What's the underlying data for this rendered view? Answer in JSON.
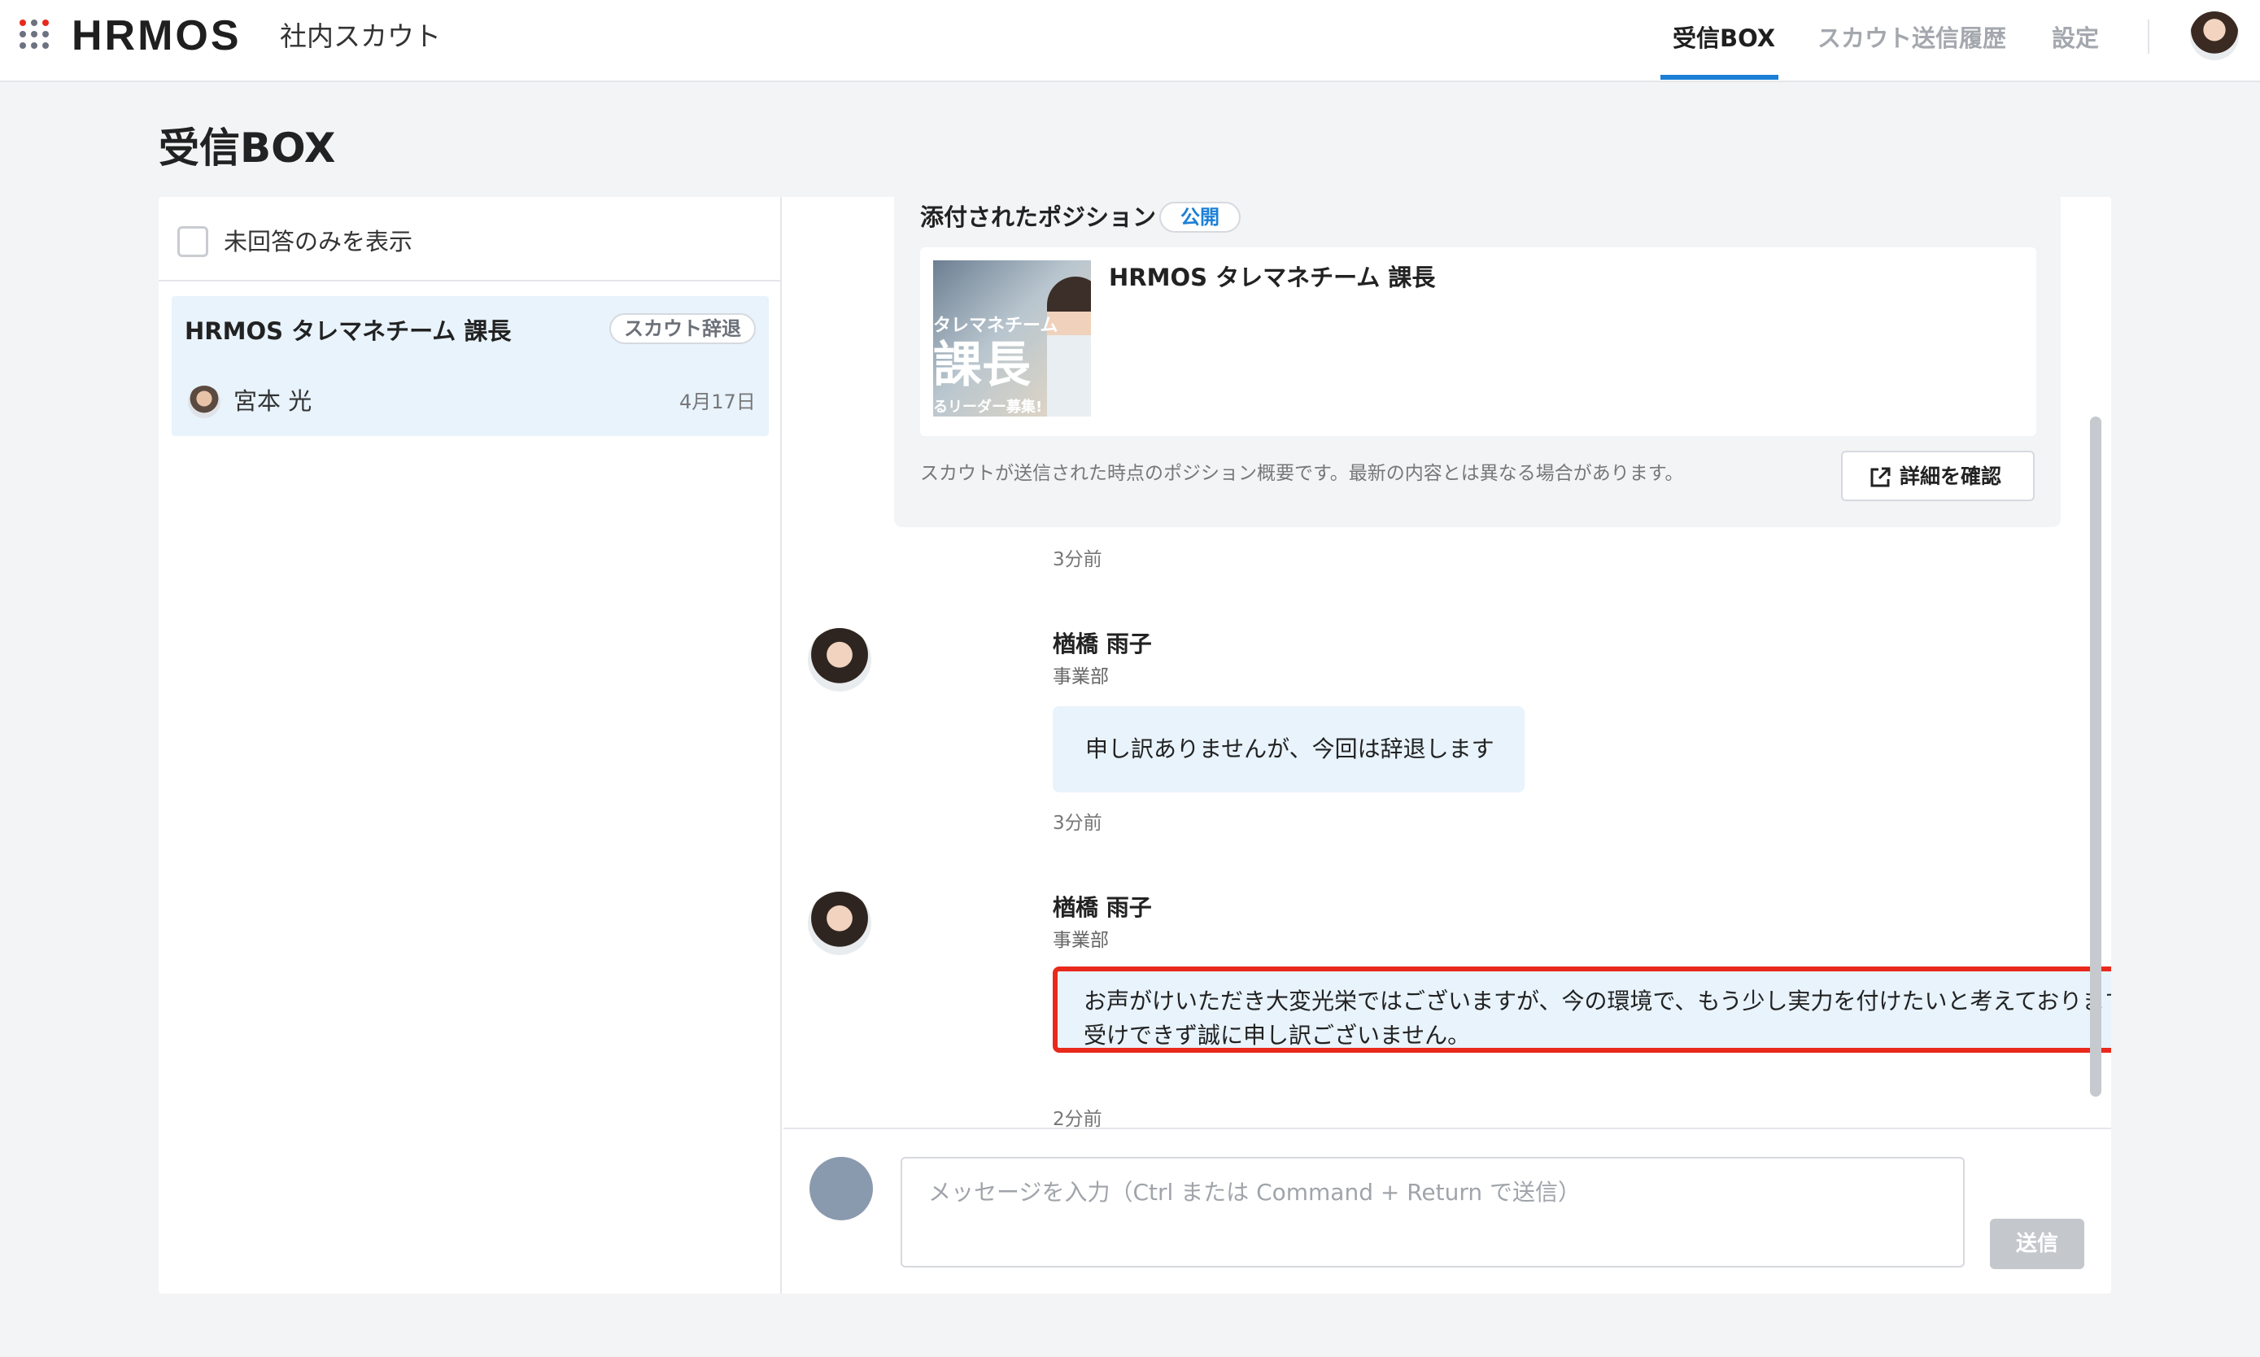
{
  "header": {
    "logo": "HRMOS",
    "product": "社内スカウト",
    "nav": [
      {
        "label": "受信BOX",
        "active": true
      },
      {
        "label": "スカウト送信履歴",
        "active": false
      },
      {
        "label": "設定",
        "active": false
      }
    ],
    "active_color": "#1b7fd6"
  },
  "page_title": "受信BOX",
  "inbox": {
    "filter_label": "未回答のみを表示",
    "filter_checked": false,
    "threads": [
      {
        "title": "HRMOS タレマネチーム 課長",
        "badge": "スカウト辞退",
        "sender": "宮本 光",
        "date": "4月17日",
        "selected": true
      }
    ]
  },
  "conversation": {
    "position": {
      "heading": "添付されたポジション",
      "visibility": "公開",
      "title": "HRMOS タレマネチーム 課長",
      "thumb_line1": "タレマネチーム",
      "thumb_line2": "課長",
      "thumb_line3": "るリーダー募集!",
      "note": "スカウトが送信された時点のポジション概要です。最新の内容とは異なる場合があります。",
      "detail_button": "詳細を確認",
      "time": "3分前"
    },
    "messages": [
      {
        "sender": "楢橋 雨子",
        "dept": "事業部",
        "text": "申し訳ありませんが、今回は辞退します",
        "time": "3分前"
      },
      {
        "sender": "楢橋 雨子",
        "dept": "事業部",
        "text": "お声がけいただき大変光栄ではございますが、今の環境で、もう少し実力を付けたいと考えております。お受けできず誠に申し訳ございません。",
        "time": "2分前",
        "highlight_color": "#e8291c"
      }
    ]
  },
  "composer": {
    "placeholder": "メッセージを入力（Ctrl または Command + Return で送信）",
    "send_label": "送信"
  }
}
